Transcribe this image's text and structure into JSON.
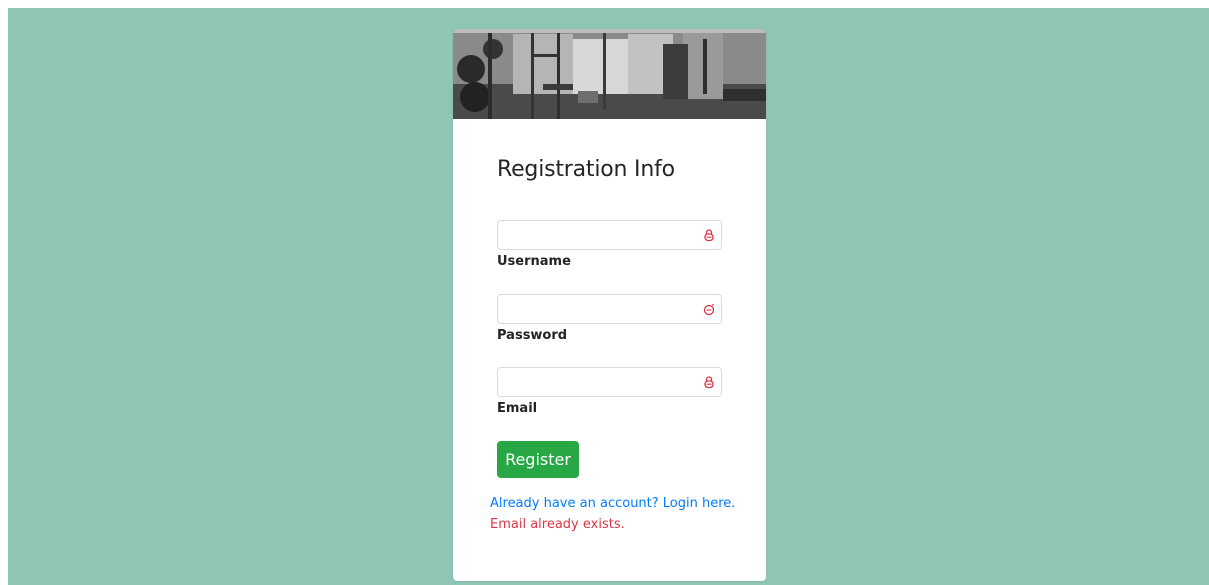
{
  "colors": {
    "page_background": "#8fc5b5",
    "card_background": "#ffffff",
    "button_background": "#28a745",
    "link": "#007bff",
    "error": "#dc3545",
    "input_icon": "#dc3545"
  },
  "banner": {
    "image": "gym-interior-photo"
  },
  "form": {
    "title": "Registration Info",
    "fields": [
      {
        "label": "Username",
        "value": "",
        "icon": "lock-icon"
      },
      {
        "label": "Password",
        "value": "",
        "icon": "key-icon"
      },
      {
        "label": "Email",
        "value": "",
        "icon": "lock-icon"
      }
    ],
    "submit_label": "Register",
    "login_link": "Already have an account? Login here.",
    "error_message": "Email already exists."
  }
}
